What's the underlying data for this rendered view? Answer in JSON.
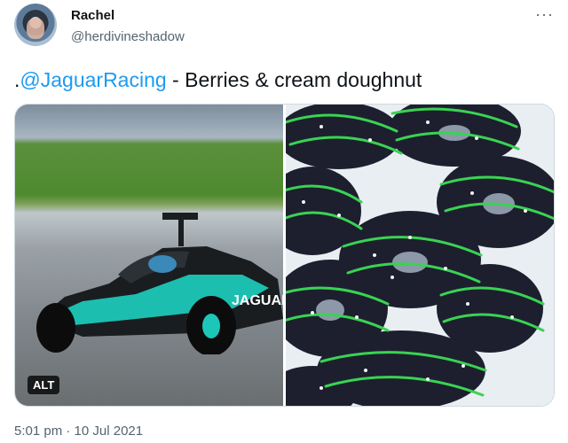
{
  "tweet": {
    "author_name": "Rachel",
    "author_handle": "@herdivineshadow",
    "text_prefix": ".",
    "mention": "@JaguarRacing",
    "text_suffix": " - Berries & cream doughnut",
    "timestamp": "5:01 pm",
    "separator": " · ",
    "date": "10 Jul 2021",
    "more_icon": "···"
  },
  "media": {
    "left_image_icon": "race-car-image",
    "right_image_icon": "doughnuts-image",
    "alt_label": "ALT",
    "car_livery_text": "JAGUAR"
  },
  "colors": {
    "link": "#1d9bf0",
    "secondary_text": "#536471",
    "border": "#cfd9de",
    "car_teal": "#1cc7b8",
    "icing_green": "#39d353"
  }
}
